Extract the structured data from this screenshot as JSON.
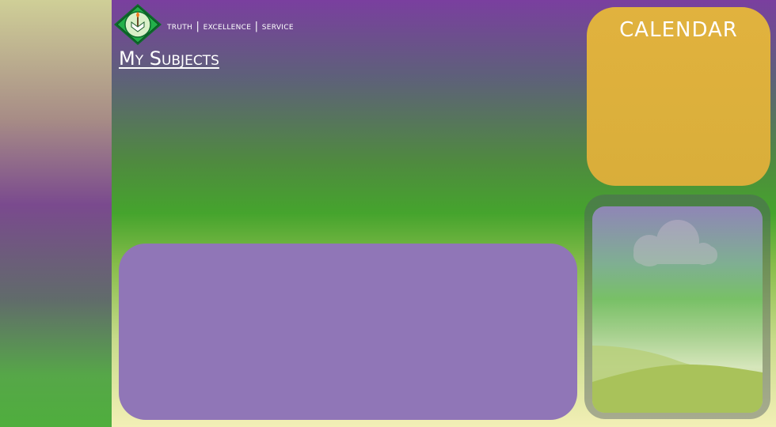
{
  "header": {
    "motto": "TRUTH | EXCELLENCE | SERVICE",
    "logo_icon": "school-crest-logo-icon"
  },
  "main": {
    "title": "My Subjects"
  },
  "calendar": {
    "title": "CALENDAR"
  },
  "weather": {
    "icon": "cloud-icon"
  },
  "colors": {
    "accent_purple": "#9076b7",
    "calendar_gold": "#dcaf3c",
    "header_purple": "#7a3f9f",
    "mid_green": "#45a42d"
  }
}
